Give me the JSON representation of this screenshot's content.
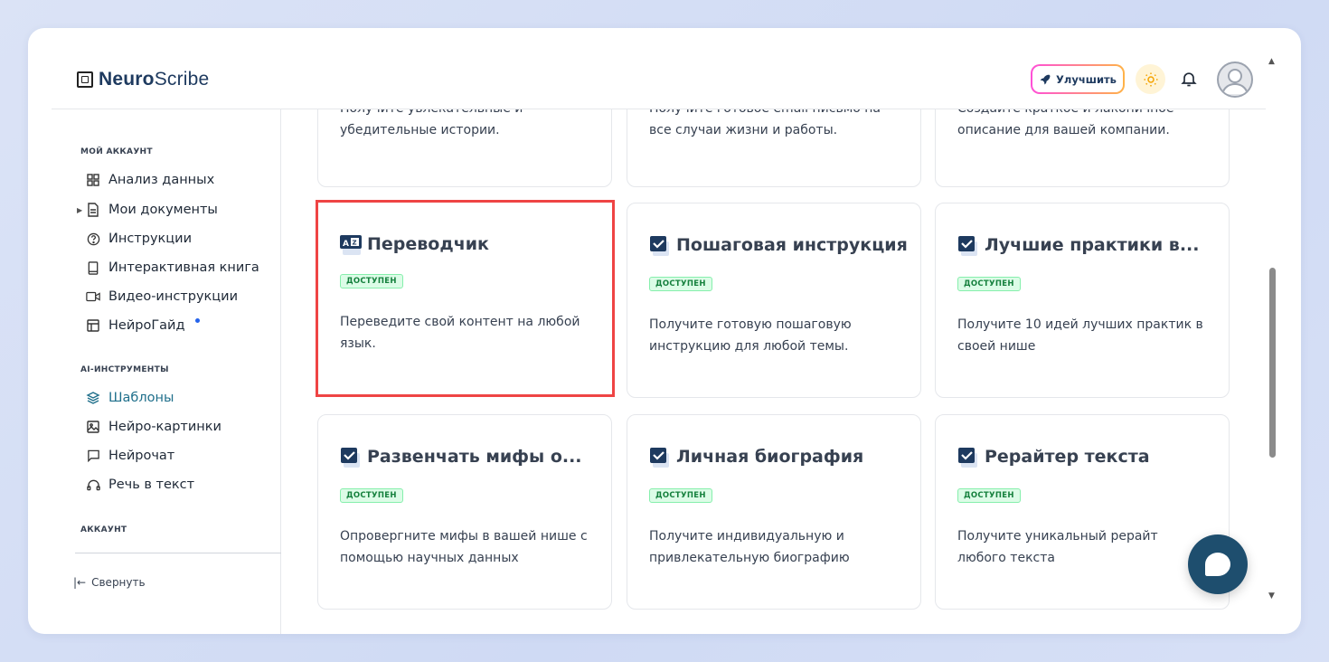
{
  "brand": {
    "name_bold": "Neuro",
    "name_rest": "Scribe"
  },
  "header": {
    "upgrade_label": "Улучшить"
  },
  "sidebar": {
    "section_account": "МОЙ АККАУНТ",
    "account_items": [
      {
        "label": "Анализ данных",
        "icon": "grid-icon"
      },
      {
        "label": "Мои документы",
        "icon": "document-icon"
      },
      {
        "label": "Инструкции",
        "icon": "help-circle-icon"
      },
      {
        "label": "Интерактивная книга",
        "icon": "book-icon"
      },
      {
        "label": "Видео-инструкции",
        "icon": "video-icon"
      },
      {
        "label": "НейроГайд",
        "icon": "layout-icon"
      }
    ],
    "section_ai": "AI-ИНСТРУМЕНТЫ",
    "ai_items": [
      {
        "label": "Шаблоны",
        "icon": "layers-icon"
      },
      {
        "label": "Нейро-картинки",
        "icon": "image-icon"
      },
      {
        "label": "Нейрочат",
        "icon": "chat-icon"
      },
      {
        "label": "Речь в текст",
        "icon": "headphones-icon"
      }
    ],
    "section_account2": "АККАУНТ",
    "collapse_label": "Свернуть"
  },
  "partial_cards": [
    {
      "line1": "Получите увлекательные и",
      "line2": "убедительные истории."
    },
    {
      "line1": "Получите готовое email письмо на",
      "line2": "все случаи жизни и работы."
    },
    {
      "line1": "Создайте краткое и лаконичное",
      "line2": "описание для вашей компании."
    }
  ],
  "cards": [
    {
      "title": "Переводчик",
      "badge": "ДОСТУПЕН",
      "desc": "Переведите свой контент на любой язык.",
      "icon": "translate-icon",
      "highlight": true
    },
    {
      "title": "Пошаговая инструкция",
      "badge": "ДОСТУПЕН",
      "desc": "Получите готовую пошаговую инструкцию для любой темы.",
      "icon": "checkbox-icon"
    },
    {
      "title": "Лучшие практики в...",
      "badge": "ДОСТУПЕН",
      "desc": "Получите 10 идей лучших практик в своей нише",
      "icon": "checkbox-icon"
    },
    {
      "title": "Развенчать мифы о...",
      "badge": "ДОСТУПЕН",
      "desc": "Опровергните мифы в вашей нише с помощью научных данных",
      "icon": "checkbox-icon"
    },
    {
      "title": "Личная биография",
      "badge": "ДОСТУПЕН",
      "desc": "Получите индивидуальную и привлекательную биографию",
      "icon": "checkbox-icon"
    },
    {
      "title": "Рерайтер текста",
      "badge": "ДОСТУПЕН",
      "desc": "Получите уникальный рерайт любого текста",
      "icon": "checkbox-icon"
    }
  ]
}
